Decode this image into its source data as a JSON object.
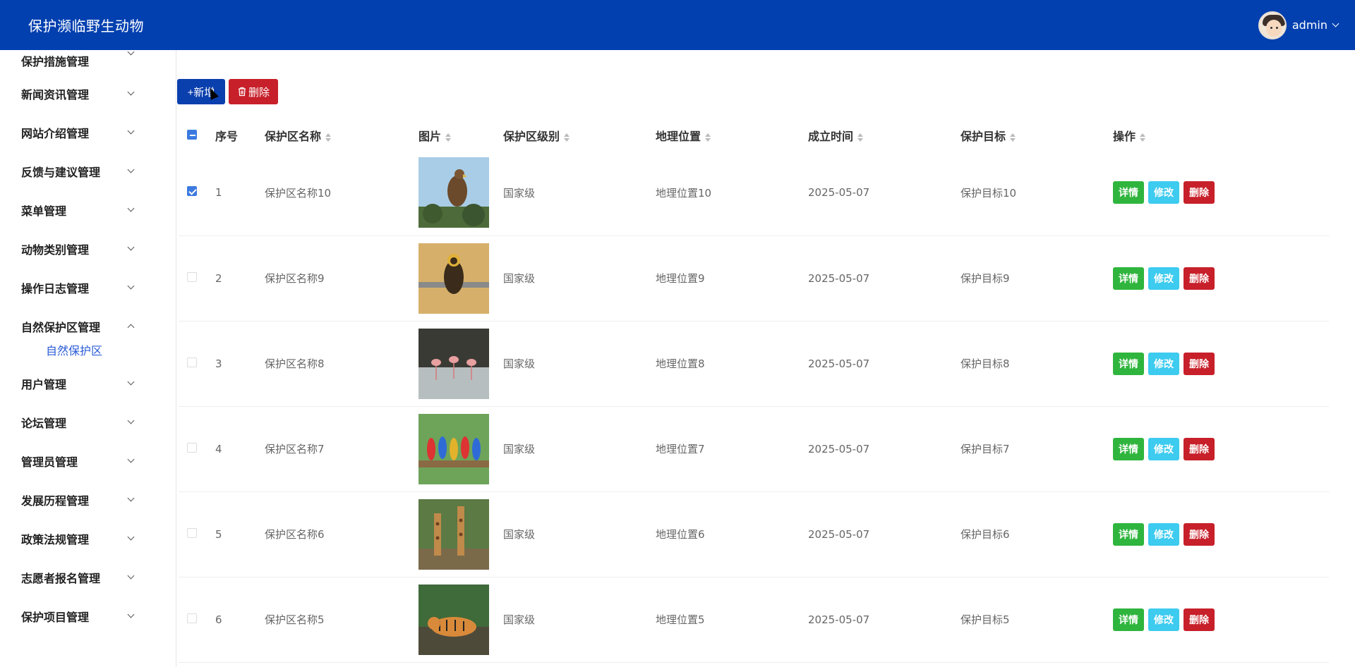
{
  "app": {
    "title": "保护濒临野生动物"
  },
  "user": {
    "name": "admin"
  },
  "sidebar": {
    "items": [
      {
        "label": "保护措施管理",
        "expanded": false
      },
      {
        "label": "新闻资讯管理",
        "expanded": false
      },
      {
        "label": "网站介绍管理",
        "expanded": false
      },
      {
        "label": "反馈与建议管理",
        "expanded": false
      },
      {
        "label": "菜单管理",
        "expanded": false
      },
      {
        "label": "动物类别管理",
        "expanded": false
      },
      {
        "label": "操作日志管理",
        "expanded": false
      },
      {
        "label": "自然保护区管理",
        "expanded": true,
        "children": [
          {
            "label": "自然保护区"
          }
        ]
      },
      {
        "label": "用户管理",
        "expanded": false
      },
      {
        "label": "论坛管理",
        "expanded": false
      },
      {
        "label": "管理员管理",
        "expanded": false
      },
      {
        "label": "发展历程管理",
        "expanded": false
      },
      {
        "label": "政策法规管理",
        "expanded": false
      },
      {
        "label": "志愿者报名管理",
        "expanded": false
      },
      {
        "label": "保护项目管理",
        "expanded": false
      }
    ]
  },
  "toolbar": {
    "add_label": "+新增",
    "delete_label": "删除"
  },
  "table": {
    "columns": [
      "序号",
      "保护区名称",
      "图片",
      "保护区级别",
      "地理位置",
      "成立时间",
      "保护目标",
      "操作"
    ],
    "rows": [
      {
        "no": "1",
        "name": "保护区名称10",
        "image": "eagle",
        "level": "国家级",
        "location": "地理位置10",
        "date": "2025-05-07",
        "target": "保护目标10",
        "checked": true
      },
      {
        "no": "2",
        "name": "保护区名称9",
        "image": "monkey",
        "level": "国家级",
        "location": "地理位置9",
        "date": "2025-05-07",
        "target": "保护目标9",
        "checked": false
      },
      {
        "no": "3",
        "name": "保护区名称8",
        "image": "flamingo",
        "level": "国家级",
        "location": "地理位置8",
        "date": "2025-05-07",
        "target": "保护目标8",
        "checked": false
      },
      {
        "no": "4",
        "name": "保护区名称7",
        "image": "parrots",
        "level": "国家级",
        "location": "地理位置7",
        "date": "2025-05-07",
        "target": "保护目标7",
        "checked": false
      },
      {
        "no": "5",
        "name": "保护区名称6",
        "image": "giraffes",
        "level": "国家级",
        "location": "地理位置6",
        "date": "2025-05-07",
        "target": "保护目标6",
        "checked": false
      },
      {
        "no": "6",
        "name": "保护区名称5",
        "image": "tiger",
        "level": "国家级",
        "location": "地理位置5",
        "date": "2025-05-07",
        "target": "保护目标5",
        "checked": false
      }
    ],
    "actions": {
      "detail": "详情",
      "edit": "修改",
      "delete": "删除"
    }
  },
  "colors": {
    "topbar": "#0240b0",
    "primary": "#0a3fae",
    "danger": "#c7202a",
    "success": "#2fb53d",
    "info": "#3dcbef"
  }
}
